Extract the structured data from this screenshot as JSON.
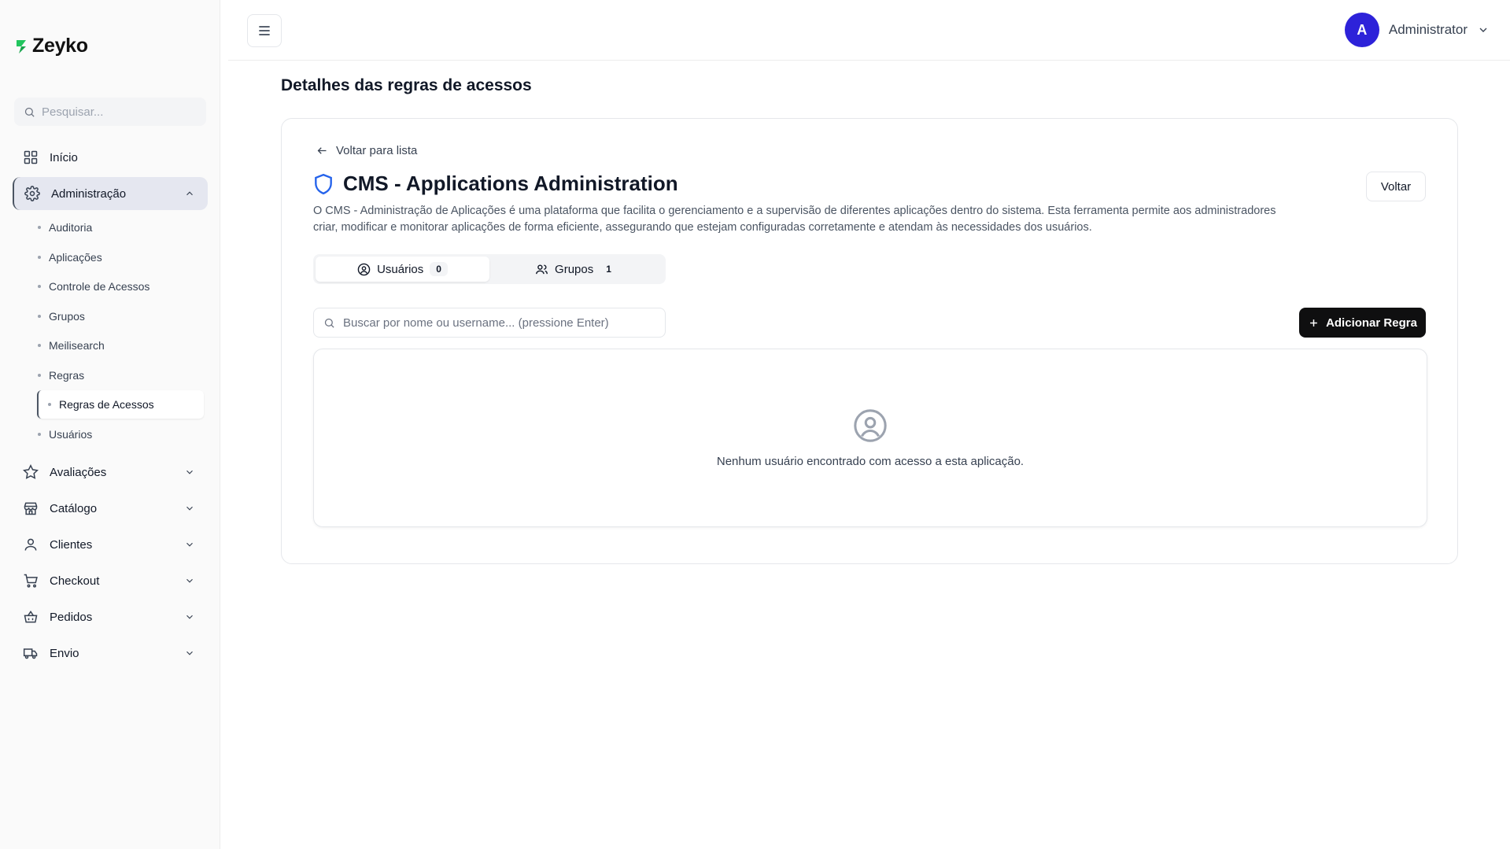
{
  "brand": {
    "name": "Zeyko",
    "accent": "#22c55e"
  },
  "sidebar": {
    "search_placeholder": "Pesquisar...",
    "items": [
      {
        "label": "Início",
        "icon": "grid-icon"
      },
      {
        "label": "Administração",
        "icon": "gear-icon",
        "expanded": true
      },
      {
        "label": "Avaliações",
        "icon": "star-icon"
      },
      {
        "label": "Catálogo",
        "icon": "store-icon"
      },
      {
        "label": "Clientes",
        "icon": "user-icon"
      },
      {
        "label": "Checkout",
        "icon": "cart-icon"
      },
      {
        "label": "Pedidos",
        "icon": "basket-icon"
      },
      {
        "label": "Envio",
        "icon": "truck-icon"
      }
    ],
    "admin_subitems": [
      "Auditoria",
      "Aplicações",
      "Controle de Acessos",
      "Grupos",
      "Meilisearch",
      "Regras",
      "Regras de Acessos",
      "Usuários"
    ],
    "active_subitem": "Regras de Acessos"
  },
  "topbar": {
    "user_initial": "A",
    "user_name": "Administrator",
    "avatar_color": "#2d22d9"
  },
  "main": {
    "page_title": "Detalhes das regras de acessos",
    "back_link": "Voltar para lista",
    "app_title": "CMS - Applications Administration",
    "back_button": "Voltar",
    "description": "O CMS - Administração de Aplicações é uma plataforma que facilita o gerenciamento e a supervisão de diferentes aplicações dentro do sistema. Esta ferramenta permite aos administradores criar, modificar e monitorar aplicações de forma eficiente, assegurando que estejam configuradas corretamente e atendam às necessidades dos usuários.",
    "tabs": [
      {
        "label": "Usuários",
        "count": "0",
        "active": true
      },
      {
        "label": "Grupos",
        "count": "1",
        "active": false
      }
    ],
    "search_placeholder": "Buscar por nome ou username... (pressione Enter)",
    "add_button": "Adicionar Regra",
    "empty_message": "Nenhum usuário encontrado com acesso a esta aplicação."
  }
}
